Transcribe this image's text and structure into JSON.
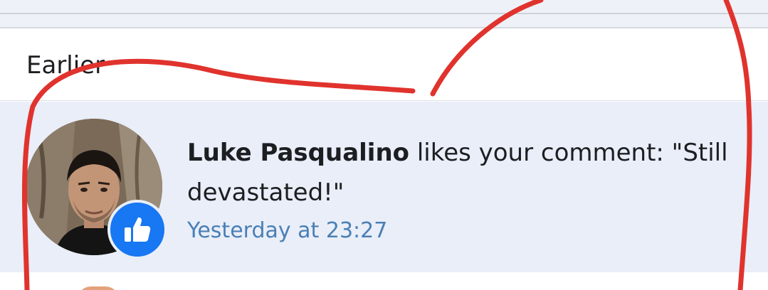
{
  "section": {
    "title": "Earlier"
  },
  "notification": {
    "actor": "Luke Pasqualino",
    "action": " likes your comment: \"Still devastated!\"",
    "timestamp": "Yesterday at 23:27",
    "reaction_icon": "thumbs-up-icon",
    "colors": {
      "unread_background": "#e9eef8",
      "badge": "#1877f2",
      "timestamp": "#4a7fb5"
    }
  },
  "annotation": {
    "color": "#e0332d",
    "shape": "hand-drawn-heart-outline"
  }
}
